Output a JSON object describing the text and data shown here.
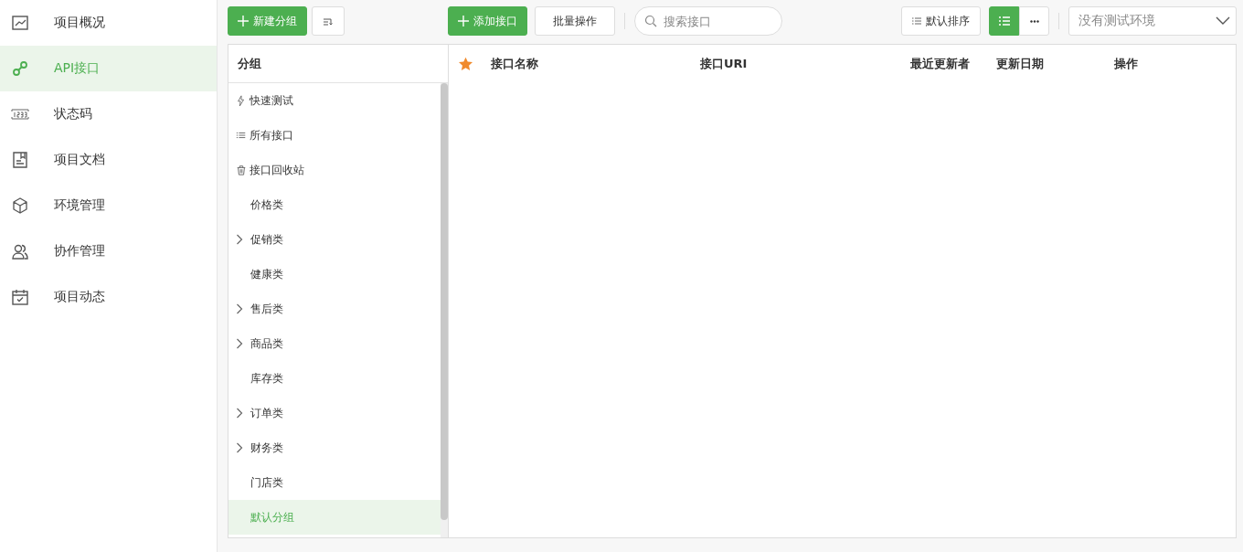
{
  "sidebar": {
    "items": [
      {
        "label": "项目概况",
        "kind": "chart",
        "selected": false
      },
      {
        "label": "API接口",
        "kind": "link",
        "selected": true
      },
      {
        "label": "状态码",
        "kind": "code",
        "selected": false
      },
      {
        "label": "项目文档",
        "kind": "doc",
        "selected": false
      },
      {
        "label": "环境管理",
        "kind": "cube",
        "selected": false
      },
      {
        "label": "协作管理",
        "kind": "users",
        "selected": false
      },
      {
        "label": "项目动态",
        "kind": "calendar",
        "selected": false
      }
    ]
  },
  "toolbar": {
    "new_group_button": "新建分组",
    "add_api_button": "添加接口",
    "batch_button": "批量操作",
    "search": {
      "placeholder": "搜索接口"
    },
    "sort_button": "默认排序",
    "view_modes": [
      {
        "kind": "list",
        "selected": true
      },
      {
        "kind": "more",
        "selected": false
      }
    ],
    "environment": {
      "placeholder": "没有测试环境"
    }
  },
  "groups": {
    "header": "分组",
    "items": [
      {
        "label": "快速测试",
        "kind": "quick",
        "selected": false
      },
      {
        "label": "所有接口",
        "kind": "all",
        "selected": false
      },
      {
        "label": "接口回收站",
        "kind": "trash",
        "selected": false
      },
      {
        "label": "价格类",
        "kind": "group",
        "expandable": false,
        "selected": false
      },
      {
        "label": "促销类",
        "kind": "group",
        "expandable": true,
        "selected": false
      },
      {
        "label": "健康类",
        "kind": "group",
        "expandable": false,
        "selected": false
      },
      {
        "label": "售后类",
        "kind": "group",
        "expandable": true,
        "selected": false
      },
      {
        "label": "商品类",
        "kind": "group",
        "expandable": true,
        "selected": false
      },
      {
        "label": "库存类",
        "kind": "group",
        "expandable": false,
        "selected": false
      },
      {
        "label": "订单类",
        "kind": "group",
        "expandable": true,
        "selected": false
      },
      {
        "label": "财务类",
        "kind": "group",
        "expandable": true,
        "selected": false
      },
      {
        "label": "门店类",
        "kind": "group",
        "expandable": false,
        "selected": false
      },
      {
        "label": "默认分组",
        "kind": "group",
        "expandable": false,
        "selected": true
      }
    ]
  },
  "table": {
    "columns": [
      "接口名称",
      "接口URI",
      "最近更新者",
      "更新日期",
      "操作"
    ]
  }
}
